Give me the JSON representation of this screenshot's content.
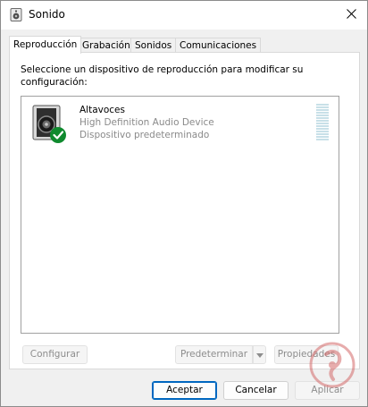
{
  "window": {
    "title": "Sonido",
    "close_icon": "close-icon",
    "app_icon": "speaker-small-icon"
  },
  "tabs": [
    {
      "label": "Reproducción",
      "active": true
    },
    {
      "label": "Grabación",
      "active": false
    },
    {
      "label": "Sonidos",
      "active": false
    },
    {
      "label": "Comunicaciones",
      "active": false
    }
  ],
  "panel": {
    "instruction": "Seleccione un dispositivo de reproducción para modificar su configuración:",
    "devices": [
      {
        "name": "Altavoces",
        "description": "High Definition Audio Device",
        "status": "Dispositivo predeterminado",
        "icon": "speaker-icon",
        "badge_icon": "default-check-icon",
        "badge_color": "#0f8a2e"
      }
    ],
    "buttons": {
      "configure": "Configurar",
      "set_default": "Predeterminar",
      "properties": "Propiedades"
    }
  },
  "footer": {
    "accept": "Aceptar",
    "cancel": "Cancelar",
    "apply": "Aplicar"
  },
  "colors": {
    "accent": "#0067c0",
    "level_meter": "#c8e0e8"
  }
}
